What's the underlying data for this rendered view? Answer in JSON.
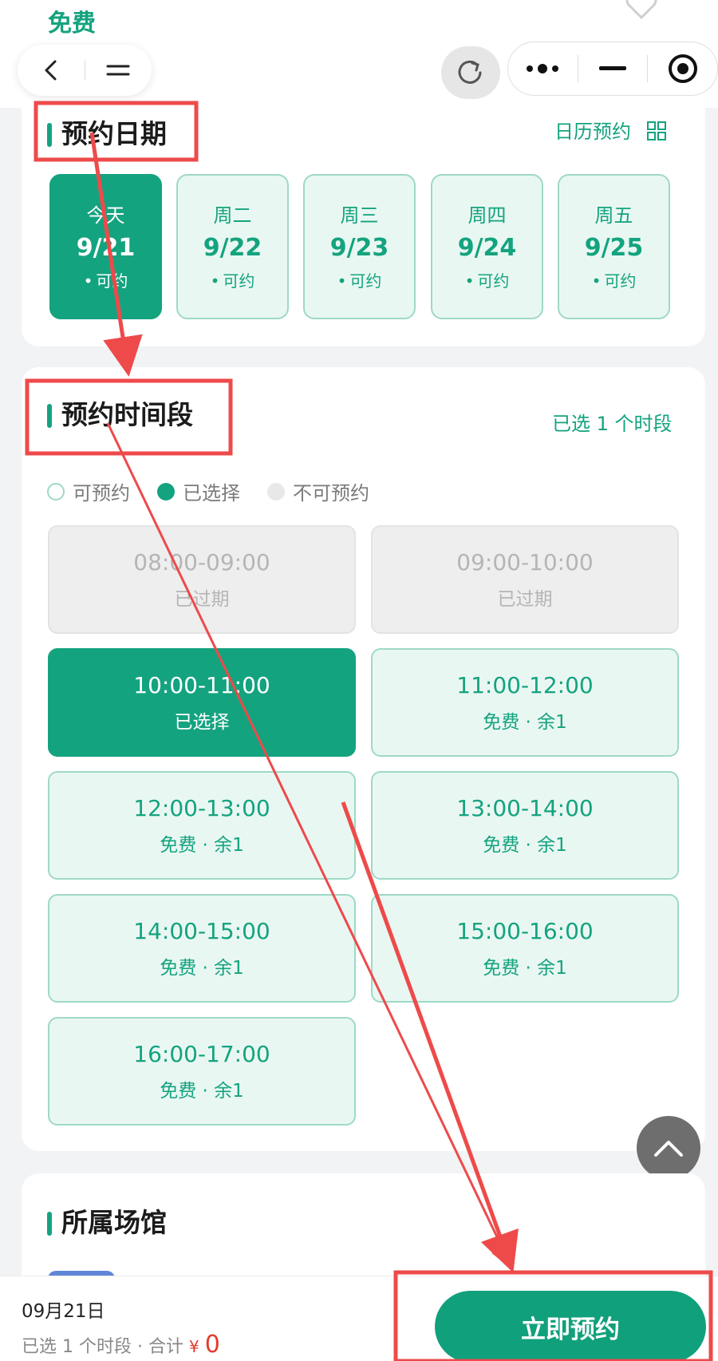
{
  "header": {
    "title": "免费"
  },
  "date_section": {
    "title": "预约日期",
    "calendar_link": "日历预约",
    "dates": [
      {
        "week": "今天",
        "date": "9/21",
        "status": "可约"
      },
      {
        "week": "周二",
        "date": "9/22",
        "status": "可约"
      },
      {
        "week": "周三",
        "date": "9/23",
        "status": "可约"
      },
      {
        "week": "周四",
        "date": "9/24",
        "status": "可约"
      },
      {
        "week": "周五",
        "date": "9/25",
        "status": "可约"
      }
    ]
  },
  "time_section": {
    "title": "预约时间段",
    "selected_summary": "已选 1 个时段",
    "legend": {
      "available": "可预约",
      "selected": "已选择",
      "unavailable": "不可预约"
    },
    "slots": [
      {
        "time": "08:00-09:00",
        "status": "已过期"
      },
      {
        "time": "09:00-10:00",
        "status": "已过期"
      },
      {
        "time": "10:00-11:00",
        "status": "已选择"
      },
      {
        "time": "11:00-12:00",
        "status": "免费 · 余1"
      },
      {
        "time": "12:00-13:00",
        "status": "免费 · 余1"
      },
      {
        "time": "13:00-14:00",
        "status": "免费 · 余1"
      },
      {
        "time": "14:00-15:00",
        "status": "免费 · 余1"
      },
      {
        "time": "15:00-16:00",
        "status": "免费 · 余1"
      },
      {
        "time": "16:00-17:00",
        "status": "免费 · 余1"
      }
    ]
  },
  "venue_section": {
    "title": "所属场馆"
  },
  "bottom_bar": {
    "date": "09月21日",
    "summary_prefix": "已选 1 个时段 · 合计",
    "currency": "¥",
    "total": "0",
    "book_button": "立即预约"
  },
  "colors": {
    "accent": "#14a37f",
    "price": "#e23b2e",
    "annotation": "#ee4a4a"
  },
  "icons": [
    "back-icon",
    "menu-icon",
    "refresh-icon",
    "more-icon",
    "minimize-icon",
    "close-target-icon",
    "heart-icon",
    "grid-icon",
    "arrow-up-icon"
  ]
}
